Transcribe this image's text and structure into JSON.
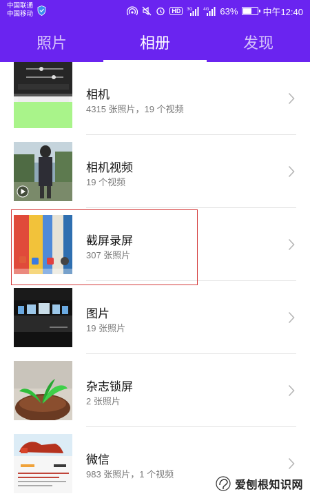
{
  "status_bar": {
    "carrier_1": "中国联通",
    "carrier_2": "中国移动",
    "network_tag": "3G",
    "network_tag_2": "4G",
    "hd_badge": "HD",
    "battery_text": "63%",
    "battery_level": 0.63,
    "time": "中午12:40"
  },
  "tabs": [
    {
      "label": "照片",
      "active": false
    },
    {
      "label": "相册",
      "active": true
    },
    {
      "label": "发现",
      "active": false
    }
  ],
  "albums": [
    {
      "name": "相机",
      "meta": "4315 张照片，19 个视频",
      "thumb": "camera-editor-screenshot"
    },
    {
      "name": "相机视频",
      "meta": "19 个视频",
      "thumb": "person-outdoors-video"
    },
    {
      "name": "截屏录屏",
      "meta": "307 张照片",
      "thumb": "colorful-homescreen"
    },
    {
      "name": "图片",
      "meta": "19 张照片",
      "thumb": "dark-gallery-wall"
    },
    {
      "name": "杂志锁屏",
      "meta": "2 张照片",
      "thumb": "green-sprout"
    },
    {
      "name": "微信",
      "meta": "983 张照片，1 个视频",
      "thumb": "wechat-post"
    }
  ],
  "highlight_color": "#d43a3a",
  "accent_color": "#6a24f0",
  "watermark": {
    "text": "爱刨根知识网"
  }
}
